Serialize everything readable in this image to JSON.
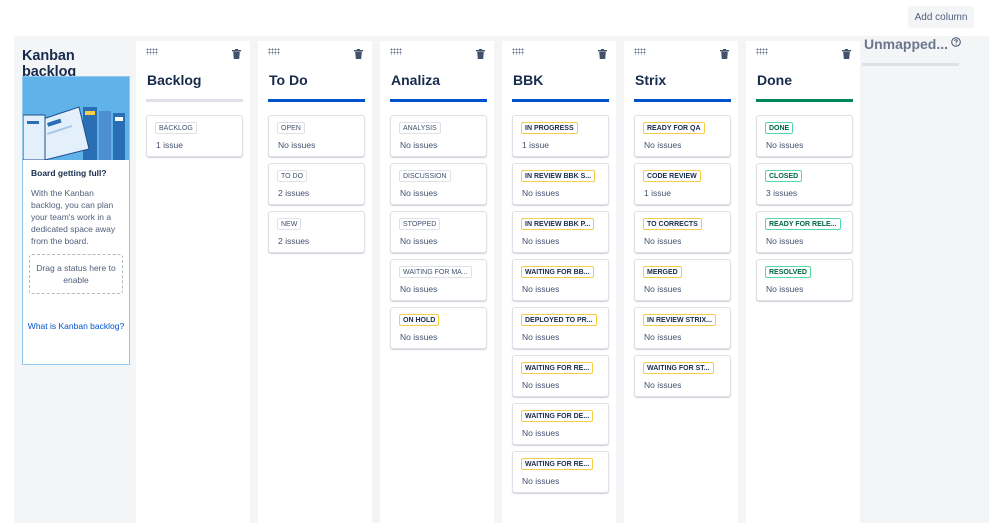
{
  "toolbar": {
    "add_column": "Add column"
  },
  "kanban_backlog": {
    "title": "Kanban backlog",
    "heading": "Board getting full?",
    "body": "With the Kanban backlog, you can plan your team's work in a dedicated space away from the board.",
    "drop_text": "Drag a status here to enable",
    "link": "What is Kanban backlog?"
  },
  "columns": [
    {
      "title": "Backlog",
      "bar_color": "#dfe1e6",
      "statuses": [
        {
          "label": "BACKLOG",
          "tone": "grey",
          "count": "1 issue"
        }
      ]
    },
    {
      "title": "To Do",
      "bar_color": "#0052cc",
      "statuses": [
        {
          "label": "OPEN",
          "tone": "grey",
          "count": "No issues"
        },
        {
          "label": "TO DO",
          "tone": "grey",
          "count": "2 issues"
        },
        {
          "label": "NEW",
          "tone": "grey",
          "count": "2 issues"
        }
      ]
    },
    {
      "title": "Analiza",
      "bar_color": "#0052cc",
      "statuses": [
        {
          "label": "ANALYSIS",
          "tone": "grey",
          "count": "No issues"
        },
        {
          "label": "DISCUSSION",
          "tone": "grey",
          "count": "No issues"
        },
        {
          "label": "STOPPED",
          "tone": "grey",
          "count": "No issues"
        },
        {
          "label": "WAITING FOR MA...",
          "tone": "grey",
          "count": "No issues"
        },
        {
          "label": "ON HOLD",
          "tone": "yellow",
          "count": "No issues"
        }
      ]
    },
    {
      "title": "BBK",
      "bar_color": "#0052cc",
      "statuses": [
        {
          "label": "IN PROGRESS",
          "tone": "yellow",
          "count": "1 issue"
        },
        {
          "label": "IN REVIEW BBK S...",
          "tone": "yellow",
          "count": "No issues"
        },
        {
          "label": "IN REVIEW BBK P...",
          "tone": "yellow",
          "count": "No issues"
        },
        {
          "label": "WAITING FOR BB...",
          "tone": "yellow",
          "count": "No issues"
        },
        {
          "label": "DEPLOYED TO PR...",
          "tone": "yellow",
          "count": "No issues"
        },
        {
          "label": "WAITING FOR RE...",
          "tone": "yellow",
          "count": "No issues"
        },
        {
          "label": "WAITING FOR DE...",
          "tone": "yellow",
          "count": "No issues"
        },
        {
          "label": "WAITING FOR RE...",
          "tone": "yellow",
          "count": "No issues"
        }
      ]
    },
    {
      "title": "Strix",
      "bar_color": "#0052cc",
      "statuses": [
        {
          "label": "READY FOR QA",
          "tone": "yellow",
          "count": "No issues"
        },
        {
          "label": "CODE REVIEW",
          "tone": "yellow",
          "count": "1 issue"
        },
        {
          "label": "TO CORRECTS",
          "tone": "yellow",
          "count": "No issues"
        },
        {
          "label": "MERGED",
          "tone": "yellow",
          "count": "No issues"
        },
        {
          "label": "IN REVIEW STRIX...",
          "tone": "yellow",
          "count": "No issues"
        },
        {
          "label": "WAITING FOR ST...",
          "tone": "yellow",
          "count": "No issues"
        }
      ]
    },
    {
      "title": "Done",
      "bar_color": "#00875a",
      "statuses": [
        {
          "label": "DONE",
          "tone": "green",
          "count": "No issues"
        },
        {
          "label": "CLOSED",
          "tone": "green",
          "count": "3 issues"
        },
        {
          "label": "READY FOR RELE...",
          "tone": "green",
          "count": "No issues"
        },
        {
          "label": "RESOLVED",
          "tone": "green",
          "count": "No issues"
        }
      ]
    }
  ],
  "unmapped": {
    "title": "Unmapped..."
  },
  "icons": {
    "drag": "drag-handle-icon",
    "trash": "trash-icon",
    "help": "question-circle-icon"
  }
}
